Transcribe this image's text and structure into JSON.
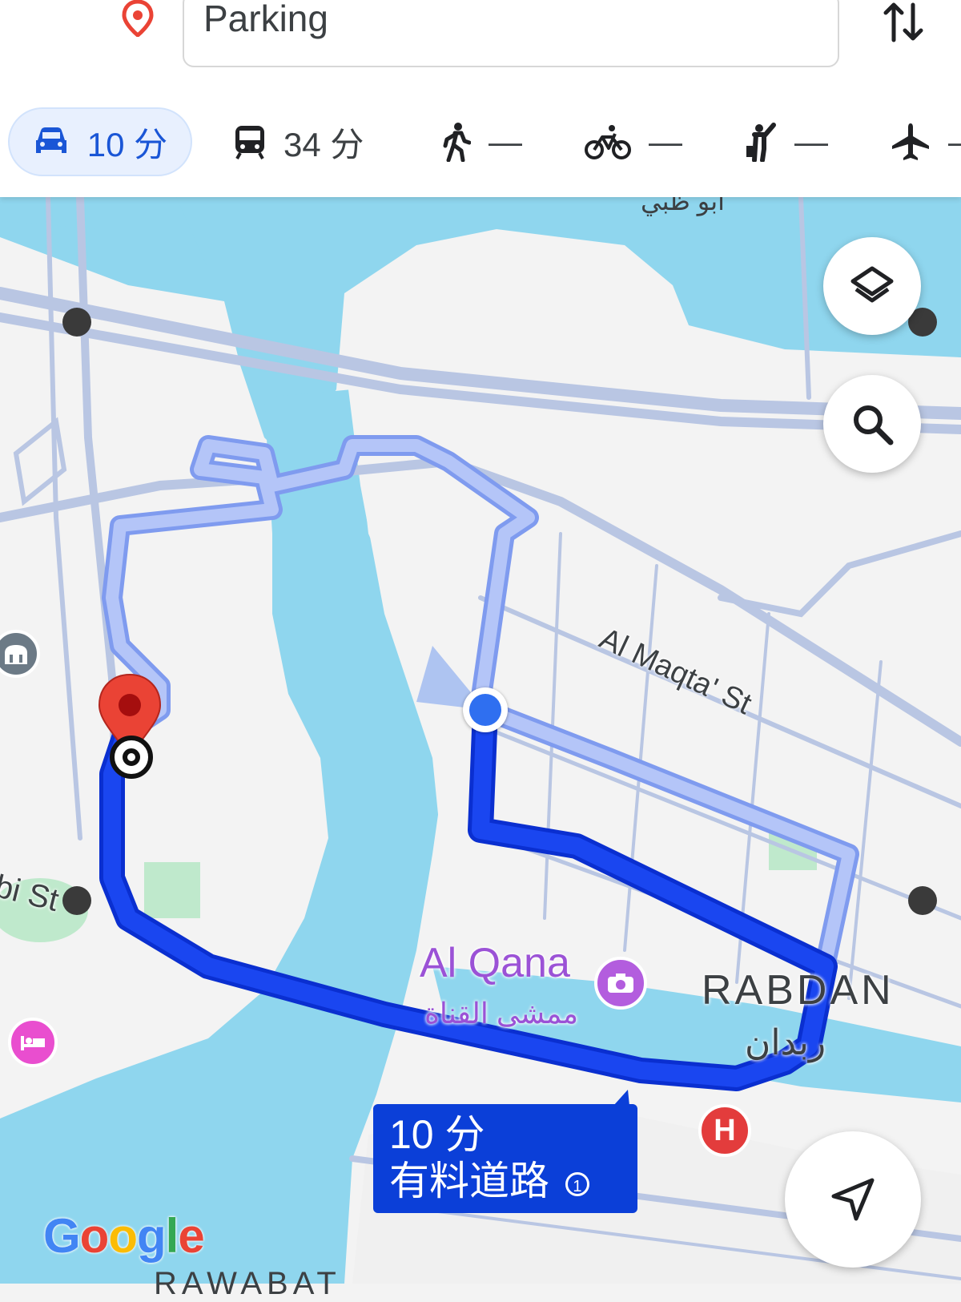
{
  "destination": {
    "value": "Parking"
  },
  "modes": [
    {
      "name": "drive",
      "value": "10 分",
      "selected": true
    },
    {
      "name": "transit",
      "value": "34 分"
    },
    {
      "name": "walk",
      "value": "—"
    },
    {
      "name": "bike",
      "value": "—"
    },
    {
      "name": "ride",
      "value": "—"
    },
    {
      "name": "flight",
      "value": "—"
    }
  ],
  "map": {
    "street_al_maqta": "Al Maqta' St",
    "street_partial": "bi St",
    "place_al_qana": "Al Qana",
    "place_al_qana_ar": "ممشى القناة",
    "area_rabdan": "RABDAN",
    "area_rabdan_ar": "ربدان",
    "area_bottom_partial": "RAWABAT",
    "top_partial_ar": "أبو ظبي"
  },
  "eta_callout": {
    "time": "10 分",
    "subtitle": "有料道路"
  },
  "attribution": "Google",
  "colors": {
    "route_primary": "#1a46f0",
    "route_alt": "#a9bdf8",
    "water": "#8fd6ee",
    "land": "#f3f3f3",
    "road": "#b9c6e3"
  }
}
